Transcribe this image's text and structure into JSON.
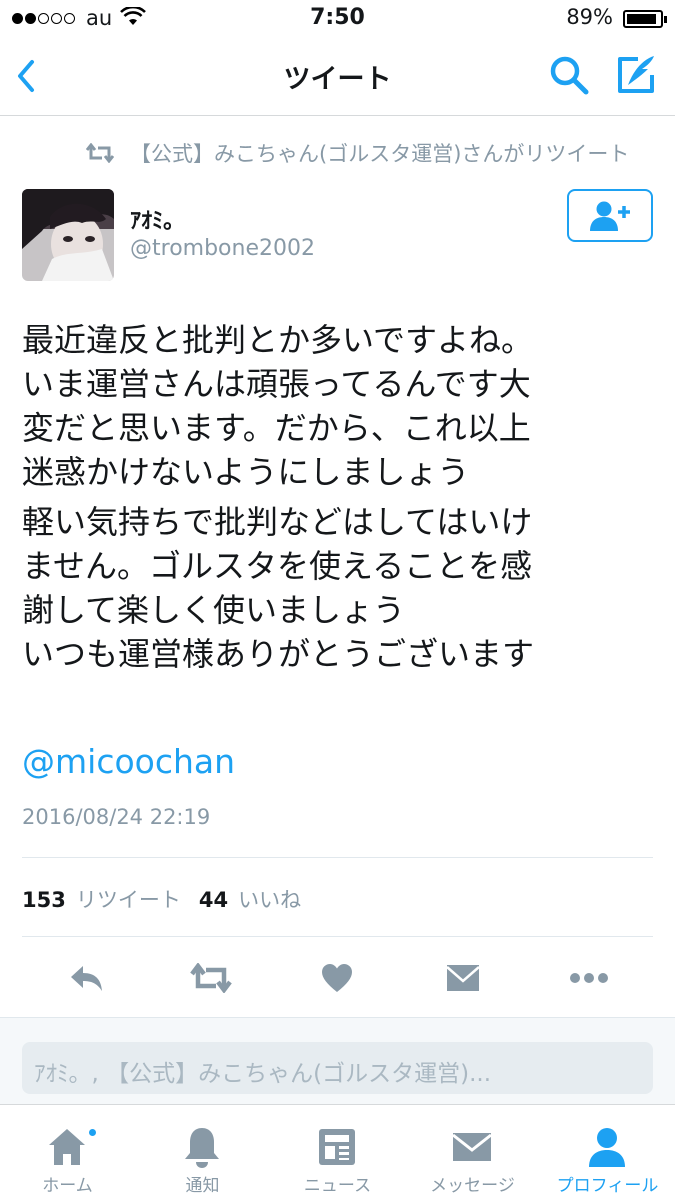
{
  "status_bar": {
    "carrier": "au",
    "time": "7:50",
    "battery_percent": "89%",
    "battery_level": 0.89,
    "signal_bars_filled": 2,
    "signal_bars_total": 5
  },
  "nav": {
    "title": "ツイート"
  },
  "retweet_context": {
    "text": "【公式】みこちゃん(ゴルスタ運営)さんがリツイート"
  },
  "tweet": {
    "display_name": "ｱｵﾐ。",
    "username": "@trombone2002",
    "text_lines": [
      "最近違反と批判とか多いですよね。",
      "いま運営さんは頑張ってるんです大",
      "変だと思います。だから、これ以上",
      "迷惑かけないようにしましょう",
      "軽い気持ちで批判などはしてはいけ",
      "ません。ゴルスタを使えることを感",
      "謝して楽しく使いましょう",
      "いつも運営様ありがとうございます"
    ],
    "mention": "@micoochan",
    "timestamp": "2016/08/24 22:19",
    "retweet_count": "153",
    "retweet_label": "リツイート",
    "like_count": "44",
    "like_label": "いいね"
  },
  "reply": {
    "placeholder": "ｱｵﾐ。, 【公式】みこちゃん(ゴルスタ運営)..."
  },
  "tabs": [
    {
      "label": "ホーム",
      "icon": "home-icon",
      "active": false
    },
    {
      "label": "通知",
      "icon": "bell-icon",
      "active": false
    },
    {
      "label": "ニュース",
      "icon": "news-icon",
      "active": false
    },
    {
      "label": "メッセージ",
      "icon": "envelope-icon",
      "active": false
    },
    {
      "label": "プロフィール",
      "icon": "profile-icon",
      "active": true
    }
  ],
  "colors": {
    "accent": "#1da1f2",
    "secondary_text": "#8899a6",
    "icon_gray": "#8899a6"
  }
}
